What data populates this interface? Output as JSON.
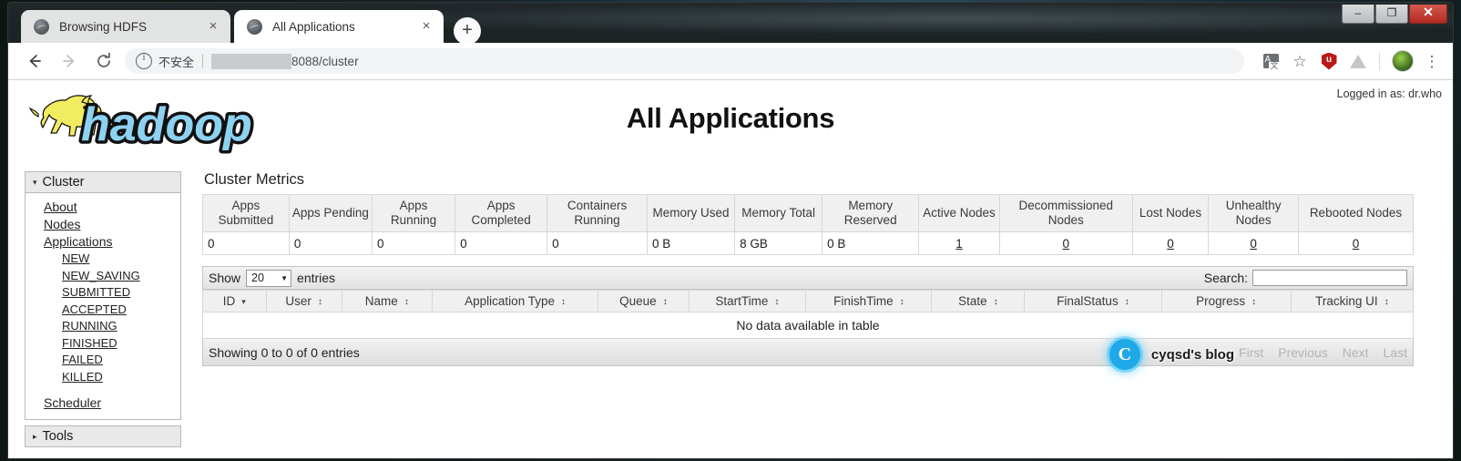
{
  "browser": {
    "tabs": [
      {
        "title": "Browsing HDFS",
        "active": false,
        "favicon": "globe-icon",
        "close": "×"
      },
      {
        "title": "All Applications",
        "active": true,
        "favicon": "globe-icon",
        "close": "×"
      }
    ],
    "new_tab_label": "+",
    "window_controls": {
      "minimize": "–",
      "maximize": "❐",
      "close": "✕"
    },
    "nav": {
      "back": "back-arrow",
      "forward": "forward-arrow",
      "reload": "reload-arrow"
    },
    "omnibox": {
      "security_label": "不安全",
      "redacted_host": "",
      "url_text": "8088/cluster"
    },
    "toolbar_icons": [
      "translate-icon",
      "bookmark-star-icon",
      "ublock-shield-icon",
      "drive-icon",
      "profile-avatar",
      "chrome-menu-icon"
    ]
  },
  "page": {
    "logged_in_as": "Logged in as: dr.who",
    "title": "All Applications",
    "logo_alt": "hadoop"
  },
  "sidebar": {
    "cluster": {
      "caret": "▾",
      "label": "Cluster",
      "links": [
        "About",
        "Nodes",
        "Applications"
      ],
      "app_states": [
        "NEW",
        "NEW_SAVING",
        "SUBMITTED",
        "ACCEPTED",
        "RUNNING",
        "FINISHED",
        "FAILED",
        "KILLED"
      ],
      "scheduler": "Scheduler"
    },
    "tools": {
      "caret": "▸",
      "label": "Tools"
    }
  },
  "main": {
    "metrics_title": "Cluster Metrics",
    "metrics_headers": [
      "Apps Submitted",
      "Apps Pending",
      "Apps Running",
      "Apps Completed",
      "Containers Running",
      "Memory Used",
      "Memory Total",
      "Memory Reserved",
      "Active Nodes",
      "Decommissioned Nodes",
      "Lost Nodes",
      "Unhealthy Nodes",
      "Rebooted Nodes"
    ],
    "metrics_values": [
      "0",
      "0",
      "0",
      "0",
      "0",
      "0 B",
      "8 GB",
      "0 B",
      "1",
      "0",
      "0",
      "0",
      "0"
    ],
    "metrics_link_from_index": 8,
    "apps_table": {
      "show_label": "Show",
      "entries_value": "20",
      "entries_label": "entries",
      "search_label": "Search:",
      "search_value": "",
      "headers": [
        {
          "label": "ID",
          "sort": "desc"
        },
        {
          "label": "User",
          "sort": "both"
        },
        {
          "label": "Name",
          "sort": "both"
        },
        {
          "label": "Application Type",
          "sort": "both"
        },
        {
          "label": "Queue",
          "sort": "both"
        },
        {
          "label": "StartTime",
          "sort": "both"
        },
        {
          "label": "FinishTime",
          "sort": "both"
        },
        {
          "label": "State",
          "sort": "both"
        },
        {
          "label": "FinalStatus",
          "sort": "both"
        },
        {
          "label": "Progress",
          "sort": "both"
        },
        {
          "label": "Tracking UI",
          "sort": "both"
        }
      ],
      "empty_message": "No data available in table",
      "showing_text": "Showing 0 to 0 of 0 entries",
      "pagination": [
        "First",
        "Previous",
        "Next",
        "Last"
      ]
    }
  },
  "watermark": {
    "logo_letter": "C",
    "text": "cyqsd's blog"
  }
}
